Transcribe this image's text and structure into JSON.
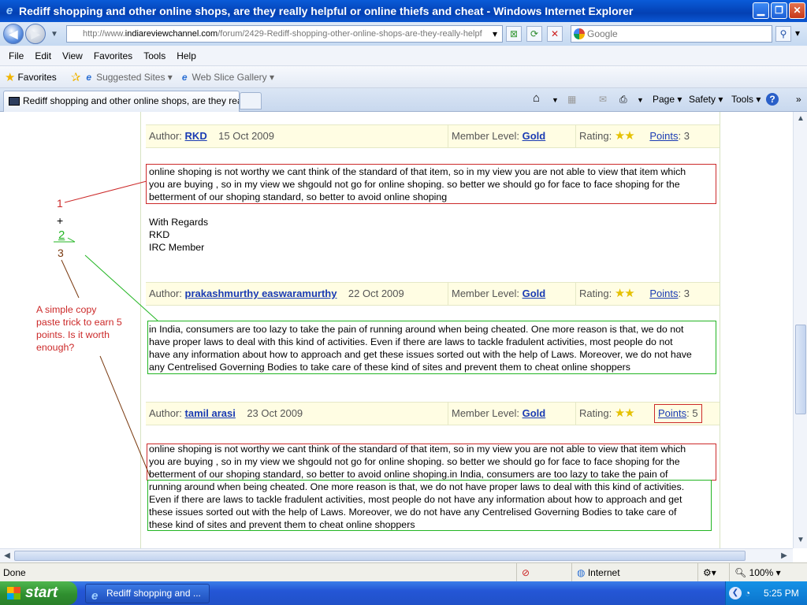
{
  "window": {
    "title": "Rediff shopping and other online shops, are they really helpful or online thiefs and cheat - Windows Internet Explorer",
    "min_symbol": "▁",
    "max_symbol": "❐",
    "close_symbol": "✕"
  },
  "address_bar": {
    "url_prefix": "http://www.",
    "url_domain": "indiareviewchannel.com",
    "url_path": "/forum/2429-Rediff-shopping-other-online-shops-are-they-really-helpf",
    "search_placeholder": "Google"
  },
  "menu": [
    "File",
    "Edit",
    "View",
    "Favorites",
    "Tools",
    "Help"
  ],
  "favorites_bar": {
    "favorites_label": "Favorites",
    "suggested_sites": "Suggested Sites ▾",
    "web_slice_gallery": "Web Slice Gallery ▾"
  },
  "tab": {
    "title": "Rediff shopping and other online shops, are they reall..."
  },
  "command_bar": {
    "page": "Page ▾",
    "safety": "Safety ▾",
    "tools": "Tools ▾",
    "help": "?",
    "more": "»"
  },
  "posts": [
    {
      "author_label": "Author:",
      "author": "RKD",
      "date": "15 Oct 2009",
      "member_level_label": "Member Level:",
      "member_level": "Gold",
      "rating_label": "Rating:",
      "points_label": "Points",
      "points_value": ": 3",
      "body_lines": [
        "online shoping is not worthy we cant think of the standard of that item, so in my view you are not able to view that item which",
        "you are buying , so in my view we shgould not go for online shoping. so better we should go for face to face shoping for the",
        "betterment of our shoping standard, so better to avoid online shoping"
      ],
      "signature": [
        "With Regards",
        "RKD",
        "IRC Member"
      ]
    },
    {
      "author_label": "Author:",
      "author": "prakashmurthy easwaramurthy",
      "date": "22 Oct 2009",
      "member_level_label": "Member Level:",
      "member_level": "Gold",
      "rating_label": "Rating:",
      "points_label": "Points",
      "points_value": ": 3",
      "body_lines": [
        "in India, consumers are too lazy to take the pain of running around when being cheated. One more reason is that, we do not",
        "have proper laws to deal with this kind of activities. Even if there are laws to tackle fradulent activities, most people do not",
        "have any information about how to approach and get these issues sorted out with the help of Laws. Moreover, we do not have",
        "any Centrelised Governing Bodies to take care of these kind of sites and prevent them to cheat online shoppers"
      ]
    },
    {
      "author_label": "Author:",
      "author": "tamil arasi",
      "date": "23 Oct 2009",
      "member_level_label": "Member Level:",
      "member_level": "Gold",
      "rating_label": "Rating:",
      "points_label": "Points",
      "points_value": ": 5",
      "body_lines": [
        "online shoping is not worthy we cant think of the standard of that item, so in my view you are not able to view that item which",
        "you are buying , so in my view we shgould not go for online shoping. so better we should go for face to face shoping for the",
        "betterment of our shoping standard, so better to avoid online shoping.in India, consumers are too lazy to take the pain of",
        "running around when being cheated. One more reason is that, we do not have proper laws to deal with this kind of activities.",
        "Even if there are laws to tackle fradulent activities, most people do not have any information about how to approach and get",
        "these issues sorted out with the help of Laws. Moreover, we do not have any Centrelised Governing Bodies to take care of",
        "these kind of sites and prevent them to cheat online shoppers"
      ]
    }
  ],
  "annotations": {
    "one": "1",
    "plus": "+",
    "two": "2",
    "three": "3",
    "note_lines": [
      "A simple copy",
      "paste trick to earn 5",
      "points. Is it worth",
      "enough?"
    ],
    "red_color": "#cc2a2a",
    "green_color": "#22b522",
    "brown_color": "#7a3a10"
  },
  "status_bar": {
    "status": "Done",
    "zone": "Internet",
    "zoom": "100%"
  },
  "taskbar": {
    "start": "start",
    "task_item": "Rediff shopping and ...",
    "clock": "5:25 PM"
  }
}
